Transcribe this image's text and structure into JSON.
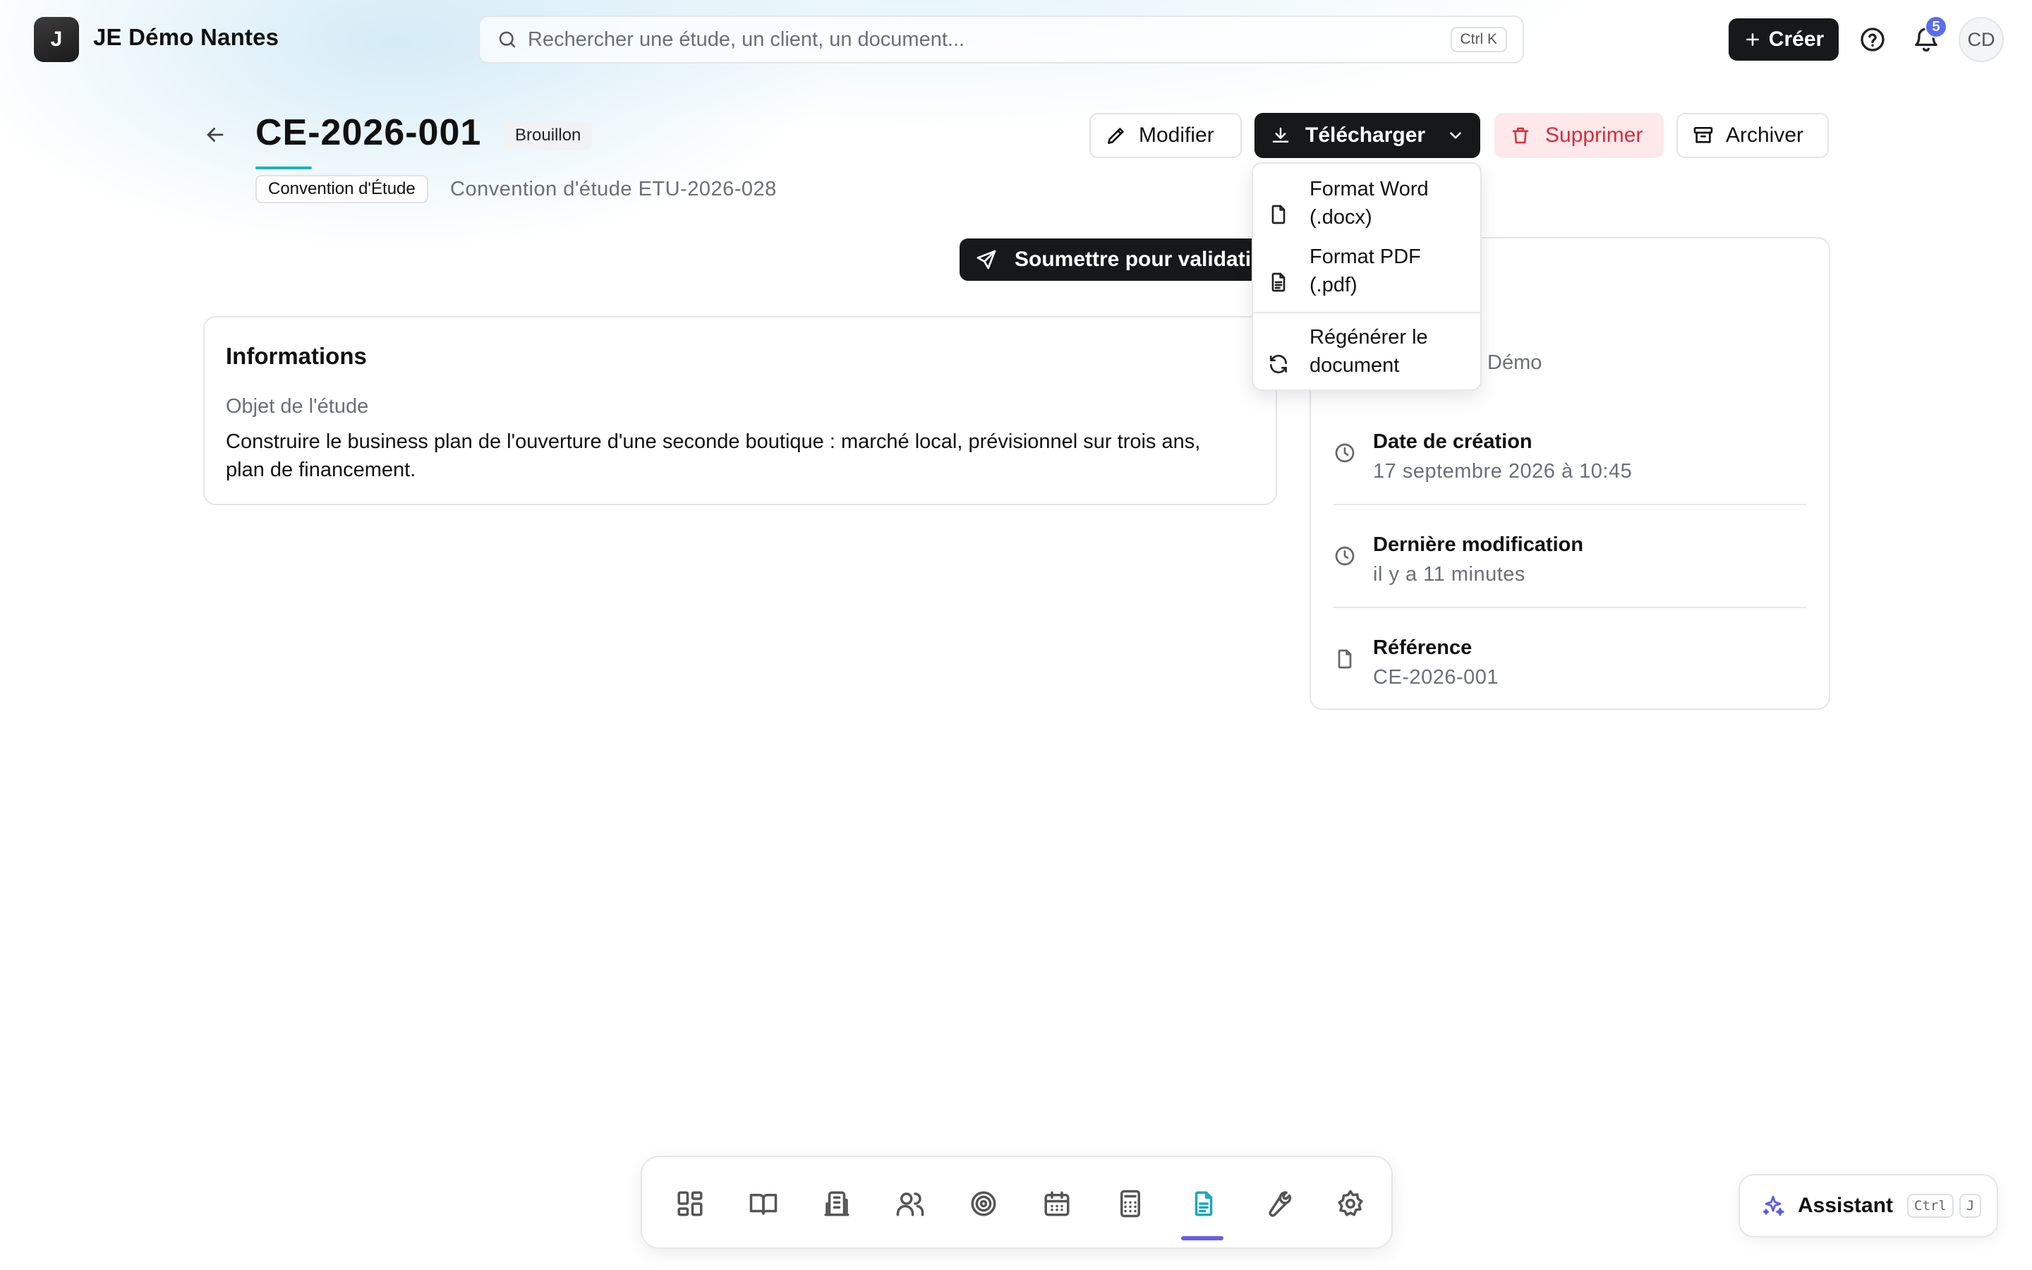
{
  "app": {
    "logo_letter": "J",
    "org_name": "JE Démo Nantes"
  },
  "search": {
    "placeholder": "Rechercher une étude, un client, un document...",
    "shortcut": "Ctrl K"
  },
  "topbar": {
    "create_label": "Créer",
    "notifications_count": "5",
    "user_initials": "CD"
  },
  "document": {
    "title": "CE-2026-001",
    "status": "Brouillon",
    "type_tag": "Convention d'Étude",
    "subtitle": "Convention d'étude ETU-2026-028"
  },
  "actions": {
    "modify": "Modifier",
    "download": "Télécharger",
    "delete": "Supprimer",
    "archive": "Archiver",
    "submit": "Soumettre pour validation"
  },
  "download_menu": {
    "items": [
      {
        "label": "Format Word (.docx)",
        "icon": "file-icon"
      },
      {
        "label": "Format PDF (.pdf)",
        "icon": "file-text-icon"
      },
      {
        "label": "Régénérer le document",
        "icon": "refresh-icon"
      }
    ]
  },
  "info": {
    "title": "Informations",
    "object_label": "Objet de l'étude",
    "object_value": "Construire le business plan de l'ouverture d'une seconde boutique : marché local, prévisionnel sur trois ans, plan de financement."
  },
  "meta": {
    "partial_value": "Démo",
    "rows": [
      {
        "label": "Date de création",
        "value": "17 septembre 2026 à 10:45",
        "icon": "clock-icon"
      },
      {
        "label": "Dernière modification",
        "value": "il y a 11 minutes",
        "icon": "clock-icon"
      },
      {
        "label": "Référence",
        "value": "CE-2026-001",
        "icon": "file-icon"
      }
    ]
  },
  "dock": {
    "items": [
      {
        "icon": "dashboard-icon",
        "active": false
      },
      {
        "icon": "book-icon",
        "active": false
      },
      {
        "icon": "building-icon",
        "active": false
      },
      {
        "icon": "users-icon",
        "active": false
      },
      {
        "icon": "target-icon",
        "active": false
      },
      {
        "icon": "calendar-icon",
        "active": false
      },
      {
        "icon": "calculator-icon",
        "active": false
      },
      {
        "icon": "document-icon",
        "active": true
      },
      {
        "icon": "wrench-icon",
        "active": false
      },
      {
        "icon": "settings-icon",
        "active": false
      }
    ]
  },
  "assistant": {
    "label": "Assistant",
    "key1": "Ctrl",
    "key2": "J"
  },
  "colors": {
    "accent": "#1aa7c0",
    "dock_indicator": "#6a5ce6",
    "danger": "#d92d3a",
    "danger_bg": "#fde8ea",
    "primary_dark": "#16181c",
    "badge": "#5b6cf0"
  }
}
